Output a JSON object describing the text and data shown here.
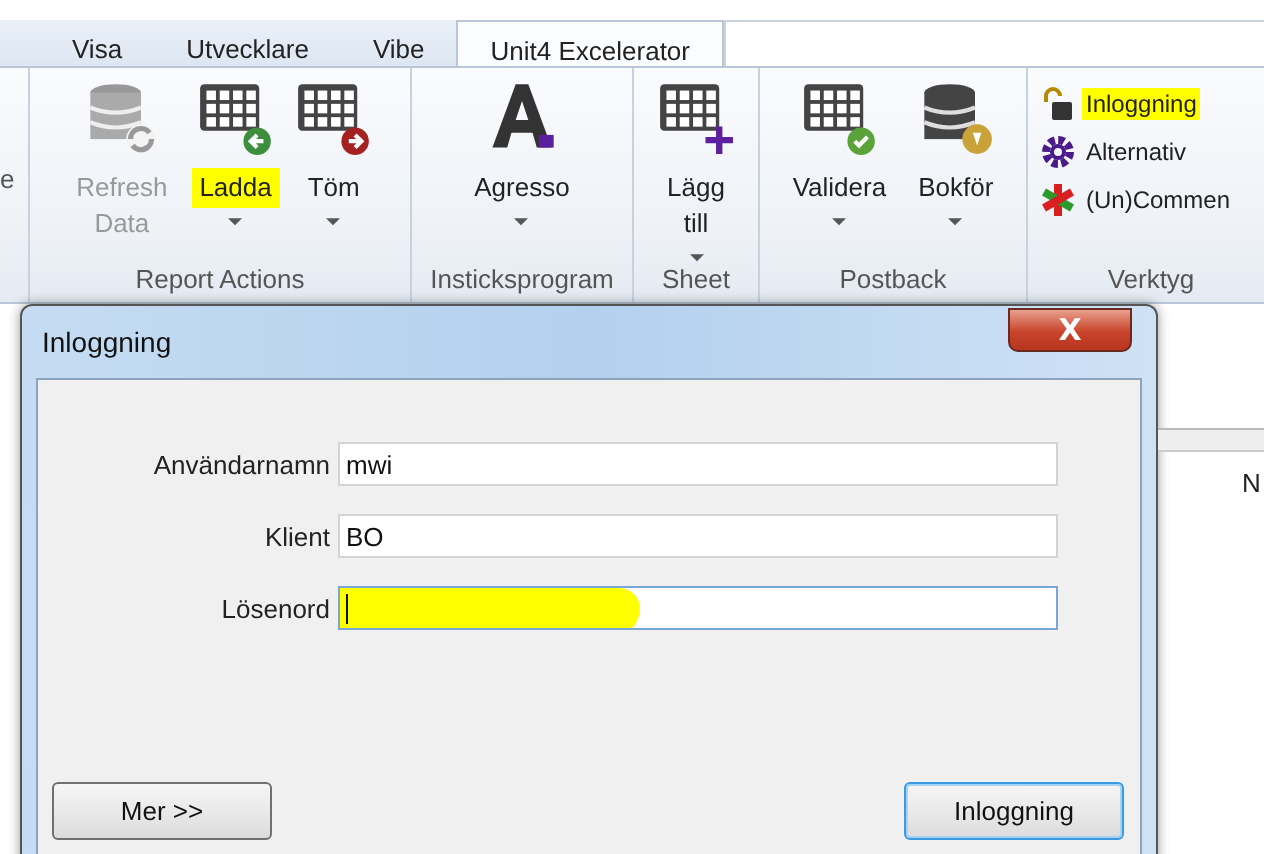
{
  "tabs": [
    {
      "label": "Visa",
      "selected": false
    },
    {
      "label": "Utvecklare",
      "selected": false
    },
    {
      "label": "Vibe",
      "selected": false
    },
    {
      "label": "Unit4 Excelerator",
      "selected": true
    }
  ],
  "ribbon": {
    "cut_group_label": "e",
    "groups": [
      {
        "label": "Report Actions",
        "buttons": [
          {
            "label": "Refresh Data",
            "disabled": true,
            "highlighted": false,
            "dropdown": false
          },
          {
            "label": "Ladda",
            "disabled": false,
            "highlighted": true,
            "dropdown": true
          },
          {
            "label": "Töm",
            "disabled": false,
            "highlighted": false,
            "dropdown": true
          }
        ]
      },
      {
        "label": "Insticksprogram",
        "buttons": [
          {
            "label": "Agresso",
            "disabled": false,
            "highlighted": false,
            "dropdown": true
          }
        ]
      },
      {
        "label": "Sheet",
        "buttons": [
          {
            "label": "Lägg till",
            "disabled": false,
            "highlighted": false,
            "dropdown": true
          }
        ]
      },
      {
        "label": "Postback",
        "buttons": [
          {
            "label": "Validera",
            "disabled": false,
            "highlighted": false,
            "dropdown": true
          },
          {
            "label": "Bokför",
            "disabled": false,
            "highlighted": false,
            "dropdown": true
          }
        ]
      },
      {
        "label": "Verktyg",
        "small_buttons": [
          {
            "label": "Inloggning",
            "highlighted": true
          },
          {
            "label": "Alternativ",
            "highlighted": false
          },
          {
            "label": "(Un)Commen",
            "highlighted": false
          }
        ]
      }
    ]
  },
  "sheet": {
    "cell_text": "N"
  },
  "dialog": {
    "title": "Inloggning",
    "close": "X",
    "fields": [
      {
        "label": "Användarnamn",
        "value": "mwi",
        "focused": false,
        "highlighted": false
      },
      {
        "label": "Klient",
        "value": "BO",
        "focused": false,
        "highlighted": false
      },
      {
        "label": "Lösenord",
        "focused": true,
        "highlighted": true
      }
    ],
    "buttons": [
      {
        "label": "Mer >>",
        "default": false
      },
      {
        "label": "Inloggning",
        "default": true
      }
    ]
  }
}
